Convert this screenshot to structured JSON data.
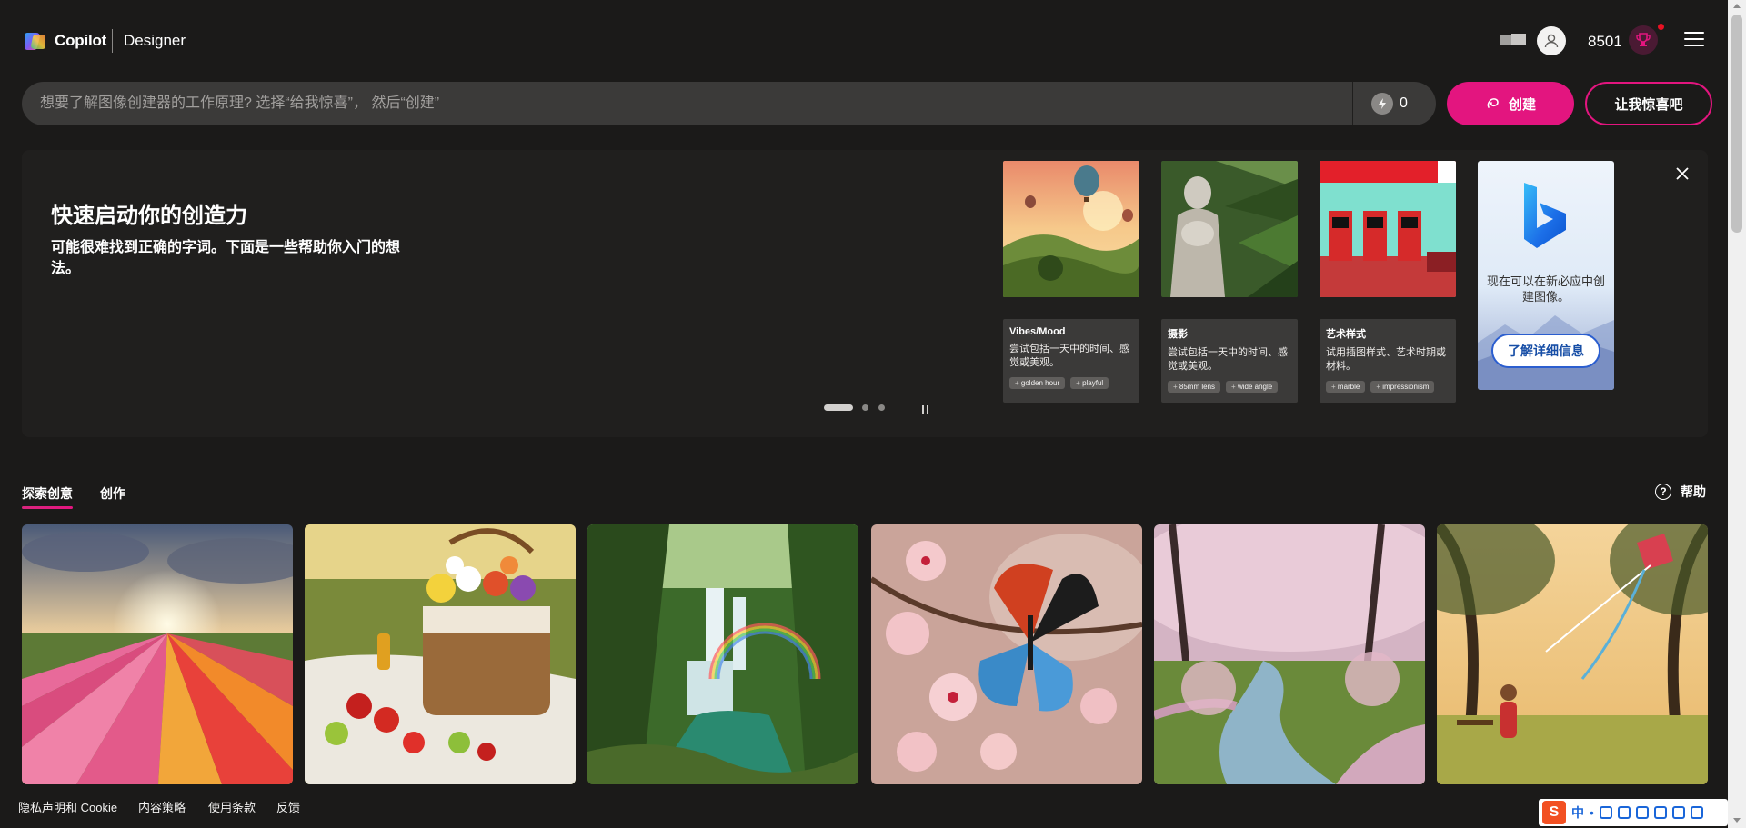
{
  "header": {
    "brand": "Copilot",
    "product": "Designer",
    "points": "8501",
    "icons": [
      "copilot-logo-icon",
      "folder-icon",
      "user-avatar-icon",
      "trophy-icon",
      "hamburger-menu-icon"
    ]
  },
  "prompt": {
    "placeholder": "想要了解图像创建器的工作原理? 选择“给我惊喜”， 然后“创建”",
    "value": "",
    "boost_count": "0",
    "create_label": "创建",
    "surprise_label": "让我惊喜吧"
  },
  "quickstart": {
    "title": "快速启动你的创造力",
    "subtitle": "可能很难找到正确的字词。下面是一些帮助你入门的想法。",
    "cards": [
      {
        "title": "Vibes/Mood",
        "desc": "尝试包括一天中的时间、感觉或美观。",
        "tags": [
          "golden hour",
          "playful"
        ],
        "image": "hot-air-balloons-landscape"
      },
      {
        "title": "摄影",
        "desc": "尝试包括一天中的时间、感觉或美观。",
        "tags": [
          "85mm lens",
          "wide angle"
        ],
        "image": "marble-statue-palm"
      },
      {
        "title": "艺术样式",
        "desc": "试用插图样式、艺术时期或材料。",
        "tags": [
          "marble",
          "impressionism"
        ],
        "image": "retro-gas-station"
      }
    ],
    "promo": {
      "text": "现在可以在新必应中创建图像。",
      "button": "了解详细信息"
    }
  },
  "tabs": {
    "explore": "探索创意",
    "create": "创作",
    "help": "帮助"
  },
  "gallery": [
    {
      "subject": "tulip-field-sunset"
    },
    {
      "subject": "picnic-basket-flowers"
    },
    {
      "subject": "waterfall-rainbow"
    },
    {
      "subject": "butterfly-cherry-blossom"
    },
    {
      "subject": "cherry-blossom-stream"
    },
    {
      "subject": "child-flying-kite-park"
    }
  ],
  "footer": {
    "links": [
      "隐私声明和 Cookie",
      "内容策略",
      "使用条款",
      "反馈"
    ]
  },
  "ime_tray": {
    "logo": "S",
    "lang": "中"
  },
  "colors": {
    "background": "#1b1a19",
    "accent": "#e3157f",
    "panel": "#201f1e",
    "input": "#3b3a39"
  }
}
